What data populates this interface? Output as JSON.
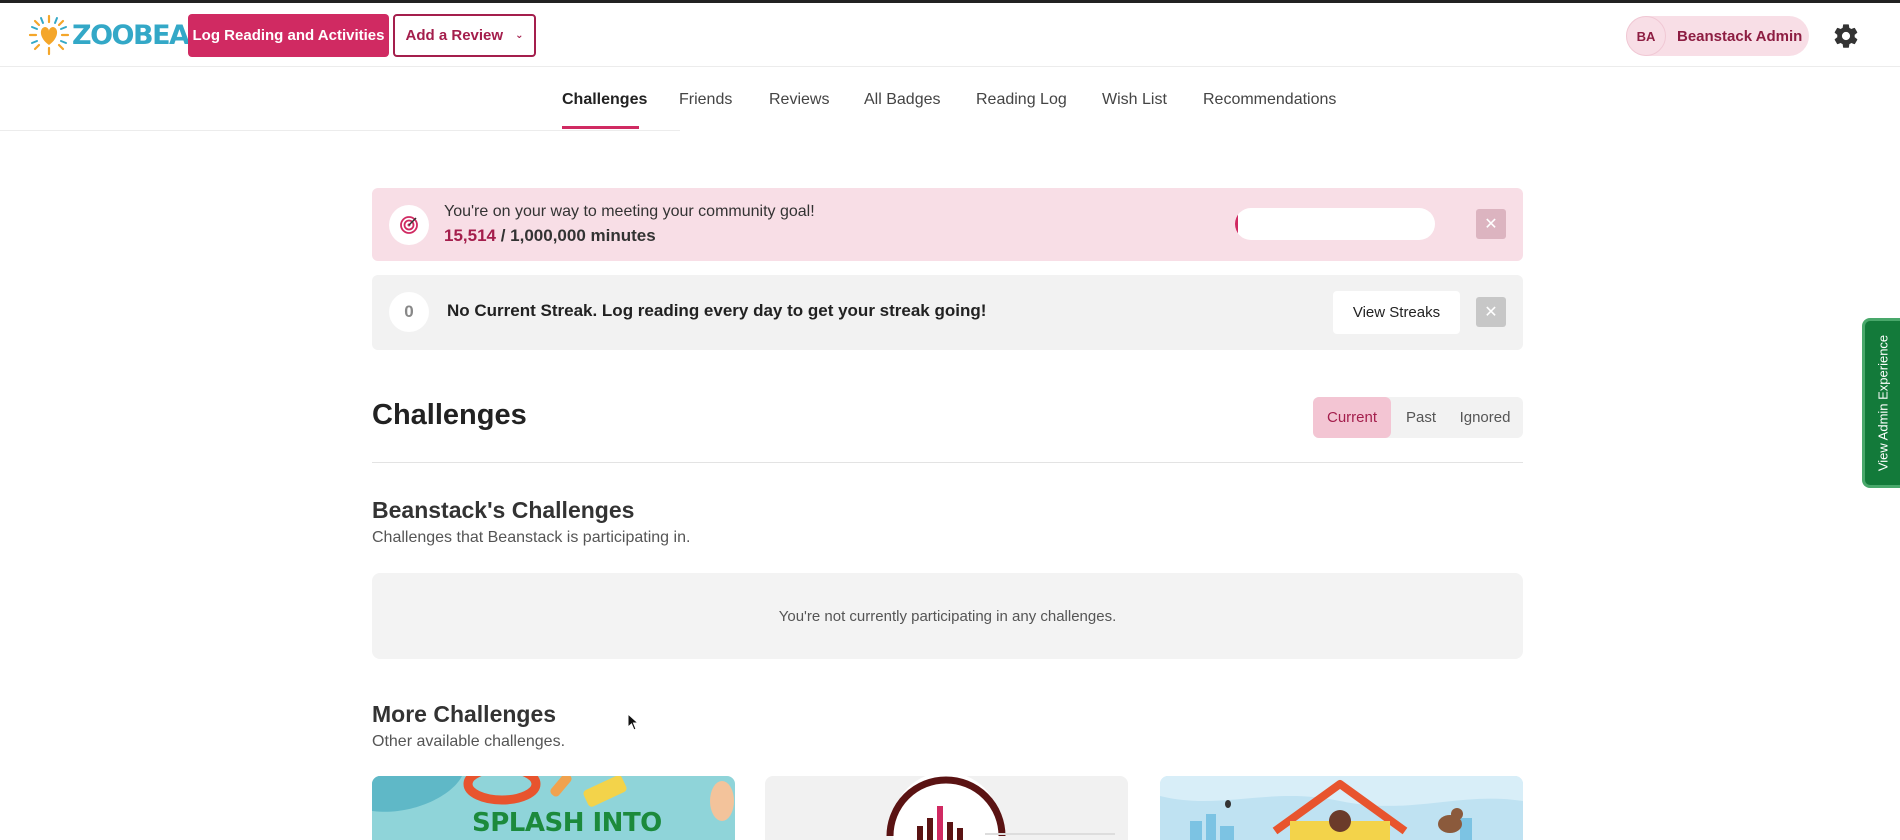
{
  "header": {
    "logo_text": "ZOOBEAN",
    "log_button": "Log Reading and Activities",
    "review_button": "Add a Review",
    "user": {
      "initials": "BA",
      "name": "Beanstack Admin"
    }
  },
  "nav": {
    "items": [
      "Challenges",
      "Friends",
      "Reviews",
      "All Badges",
      "Reading Log",
      "Wish List",
      "Recommendations"
    ],
    "active": "Challenges"
  },
  "goal_banner": {
    "title": "You're on your way to meeting your community goal!",
    "current": "15,514",
    "rest": " / 1,000,000 minutes",
    "progress_fraction": 0.015514,
    "progress_label": "I"
  },
  "streak_banner": {
    "count": "0",
    "text": "No Current Streak. Log reading every day to get your streak going!",
    "button": "View Streaks"
  },
  "challenges": {
    "title": "Challenges",
    "filters": [
      "Current",
      "Past",
      "Ignored"
    ],
    "active_filter": "Current"
  },
  "my_challenges": {
    "title": "Beanstack's Challenges",
    "subtitle": "Challenges that Beanstack is participating in.",
    "empty_message": "You're not currently participating in any challenges."
  },
  "more_challenges": {
    "title": "More Challenges",
    "subtitle": "Other available challenges.",
    "cards": [
      {
        "title": "SPLASH INTO"
      },
      {
        "title": ""
      },
      {
        "title": ""
      }
    ]
  },
  "side_tab": {
    "label": "View Admin Experience"
  },
  "colors": {
    "brand_pink": "#d02a62",
    "brand_maroon": "#a41e4c",
    "logo_blue": "#33a8c7",
    "admin_green": "#137a3a"
  }
}
